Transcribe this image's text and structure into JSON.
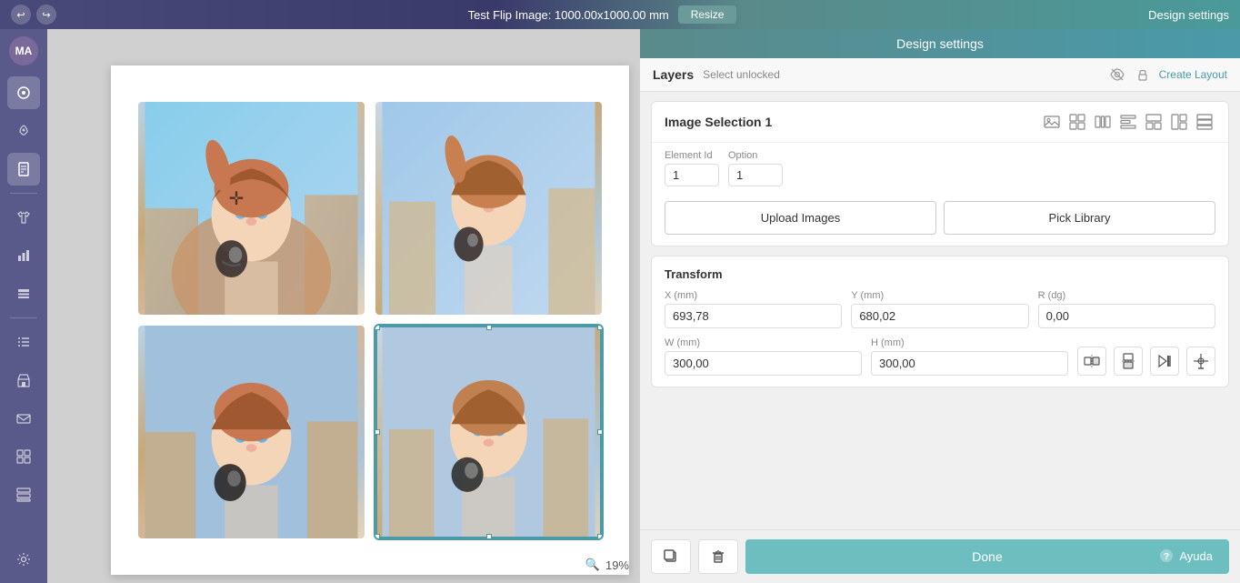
{
  "topbar": {
    "title": "Test Flip Image: 1000.00x1000.00 mm",
    "resize_label": "Resize",
    "right_label": "Design settings"
  },
  "sidebar": {
    "avatar": "MA",
    "items": [
      {
        "id": "home",
        "icon": "⊙",
        "label": "Home"
      },
      {
        "id": "rocket",
        "icon": "🚀",
        "label": "Launch"
      },
      {
        "id": "doc",
        "icon": "📄",
        "label": "Document",
        "active": true
      },
      {
        "id": "shirt",
        "icon": "👕",
        "label": "Products"
      },
      {
        "id": "chart",
        "icon": "📊",
        "label": "Analytics"
      },
      {
        "id": "layers",
        "icon": "📋",
        "label": "Layers"
      },
      {
        "id": "list",
        "icon": "☰",
        "label": "List"
      },
      {
        "id": "store",
        "icon": "🏪",
        "label": "Store"
      },
      {
        "id": "mail",
        "icon": "✉",
        "label": "Mail"
      },
      {
        "id": "table",
        "icon": "⊞",
        "label": "Table"
      },
      {
        "id": "rows",
        "icon": "⊟",
        "label": "Rows"
      },
      {
        "id": "settings",
        "icon": "⚙",
        "label": "Settings"
      }
    ]
  },
  "canvas": {
    "zoom_icon": "🔍",
    "zoom_value": "19%"
  },
  "layers": {
    "title": "Layers",
    "select_unlocked": "Select unlocked",
    "create_layout": "Create Layout"
  },
  "image_selection": {
    "title": "Image Selection 1",
    "element_id_label": "Element Id",
    "element_id_value": "1",
    "option_label": "Option",
    "option_value": "1",
    "upload_btn": "Upload Images",
    "library_btn": "Pick Library"
  },
  "transform": {
    "title": "Transform",
    "x_label": "X (mm)",
    "x_value": "693,78",
    "y_label": "Y (mm)",
    "y_value": "680,02",
    "r_label": "R (dg)",
    "r_value": "0,00",
    "w_label": "W (mm)",
    "w_value": "300,00",
    "h_label": "H (mm)",
    "h_value": "300,00"
  },
  "actions": {
    "done_label": "Done",
    "ayuda_label": "Ayuda"
  }
}
